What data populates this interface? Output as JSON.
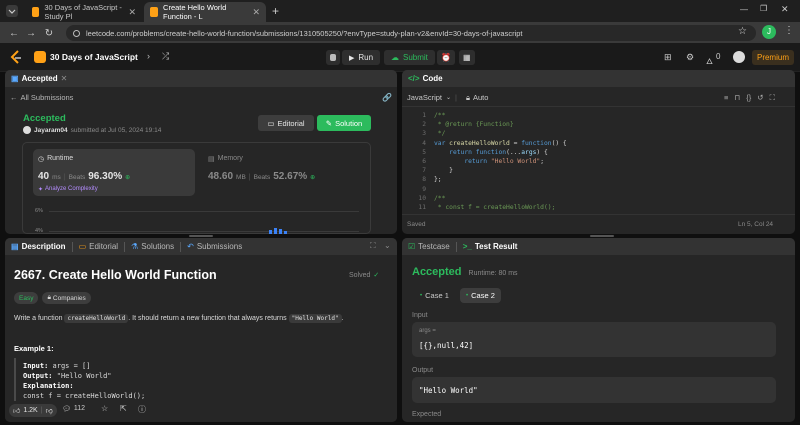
{
  "browser": {
    "tabs": [
      {
        "title": "30 Days of JavaScript - Study Pl"
      },
      {
        "title": "Create Hello World Function - L"
      }
    ],
    "url": "leetcode.com/problems/create-hello-world-function/submissions/1310505250/?envType=study-plan-v2&envId=30-days-of-javascript",
    "profile_initial": "J"
  },
  "appbar": {
    "plan_title": "30 Days of JavaScript",
    "run_label": "Run",
    "submit_label": "Submit",
    "fire_count": "0",
    "premium_label": "Premium"
  },
  "submission_panel": {
    "tab_label": "Accepted",
    "back_label": "All Submissions",
    "status": "Accepted",
    "user": "Jayaram04",
    "submitted_text": "submitted at Jul 05, 2024 19:14",
    "editorial_label": "Editorial",
    "solution_label": "Solution",
    "runtime": {
      "label": "Runtime",
      "value": "40",
      "unit": "ms",
      "beats_label": "Beats",
      "beats": "96.30%",
      "analyze_label": "Analyze Complexity"
    },
    "memory": {
      "label": "Memory",
      "value": "48.60",
      "unit": "MB",
      "beats_label": "Beats",
      "beats": "52.67%"
    },
    "chart_ticks": [
      "6%",
      "4%"
    ]
  },
  "code_panel": {
    "tab_label": "Code",
    "language": "JavaScript",
    "mode": "Auto",
    "lines": [
      {
        "n": "1",
        "t": "/**"
      },
      {
        "n": "2",
        "t": " * @return {Function}"
      },
      {
        "n": "3",
        "t": " */"
      },
      {
        "n": "4",
        "t": "var createHelloWorld = function() {"
      },
      {
        "n": "5",
        "t": "    return function(...args) {"
      },
      {
        "n": "6",
        "t": "        return \"Hello World\";"
      },
      {
        "n": "7",
        "t": "    }"
      },
      {
        "n": "8",
        "t": "};"
      },
      {
        "n": "9",
        "t": ""
      },
      {
        "n": "10",
        "t": "/**"
      },
      {
        "n": "11",
        "t": " * const f = createHelloWorld();"
      }
    ],
    "saved_label": "Saved",
    "cursor_pos": "Ln 5, Col 24"
  },
  "description_panel": {
    "tabs": [
      "Description",
      "Editorial",
      "Solutions",
      "Submissions"
    ],
    "title": "2667. Create Hello World Function",
    "solved_label": "Solved",
    "difficulty": "Easy",
    "companies_label": "Companies",
    "text_before": "Write a function",
    "fn_name": "createHelloWorld",
    "text_middle": ". It should return a new function that always returns",
    "return_value": "\"Hello World\"",
    "text_after": ".",
    "example_heading": "Example 1:",
    "example": {
      "input_label": "Input:",
      "input_value": "args = []",
      "output_label": "Output:",
      "output_value": "\"Hello World\"",
      "explanation_label": "Explanation:",
      "code_line": "const f = createHelloWorld();"
    },
    "likes": "1.2K",
    "comments": "112"
  },
  "result_panel": {
    "tabs": [
      "Testcase",
      "Test Result"
    ],
    "status": "Accepted",
    "runtime_text": "Runtime: 80 ms",
    "cases": [
      "Case 1",
      "Case 2"
    ],
    "input_label": "Input",
    "args_label": "args =",
    "args_value": "[{},null,42]",
    "output_label": "Output",
    "output_value": "\"Hello World\"",
    "expected_label": "Expected"
  },
  "colors": {
    "accent_green": "#2cbb5d",
    "brand_orange": "#ffa116",
    "premium": "#ffa116"
  }
}
